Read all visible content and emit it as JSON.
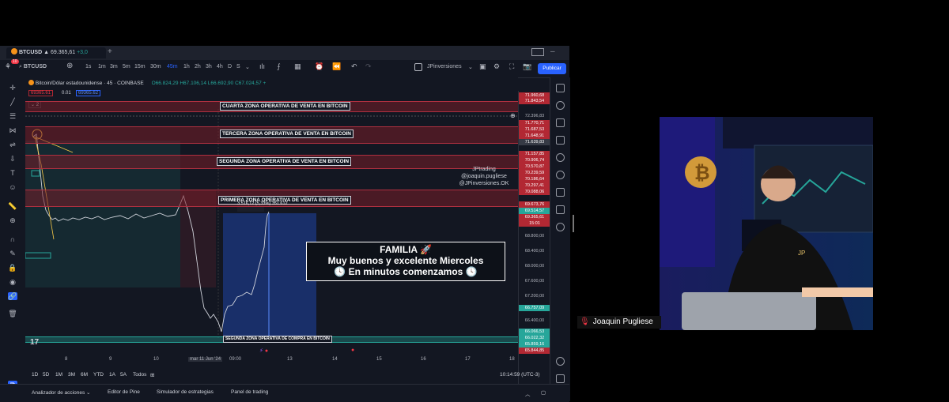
{
  "window": {
    "tab_symbol": "BTCUSD",
    "tab_price": "69.365,61",
    "tab_change": "+3,0",
    "badge_count": "10"
  },
  "toolbar": {
    "symbol": "BTCUSD",
    "intervals": [
      "1s",
      "1m",
      "3m",
      "5m",
      "15m",
      "30m",
      "45m",
      "1h",
      "2h",
      "3h",
      "4h",
      "D",
      "S"
    ],
    "active_interval": "45m",
    "layout_name": "JPinversiones",
    "publish_label": "Publicar"
  },
  "legend": {
    "title": "Bitcoin/Dólar estadounidense · 45 · COINBASE",
    "ohlc": "O66.824,29 H67.106,14 L66.692,90 C67.024,57 +",
    "bid": "69365.61",
    "spread": "0.01",
    "ask": "69365.62",
    "indicator_count": "2"
  },
  "zones": [
    "CUARTA ZONA OPERATIVA DE VENTA EN BITCOIN",
    "TERCERA ZONA OPERATIVA DE VENTA EN BITCOIN",
    "SEGUNDA ZONA OPERATIVA DE VENTA EN BITCOIN",
    "PRIMERA ZONA OPERATIVA DE VENTA EN BITCOIN",
    "SEGUNDA ZONA OPERATIVA DE COMPRA EN BITCOIN"
  ],
  "measure_label": "3.516,12 (5,33%) 351.612",
  "watermark": [
    "JPtrading",
    "@joaquin.pugliese",
    "@JPinversiones.OK"
  ],
  "message": {
    "line1": "FAMILIA 🚀",
    "line2": "Muy buenos y excelente Miercoles",
    "line3": "🕓 En minutos comenzamos 🕓"
  },
  "price_labels": [
    {
      "text": "71.960,68",
      "color": "#b22833"
    },
    {
      "text": "71.843,54",
      "color": "#b22833"
    },
    {
      "text": "72.396,83",
      "color": "#131722"
    },
    {
      "text": "71.770,71",
      "color": "#b22833"
    },
    {
      "text": "71.687,53",
      "color": "#b22833"
    },
    {
      "text": "71.648,91",
      "color": "#b22833"
    },
    {
      "text": "71.639,83",
      "color": "#363a45"
    },
    {
      "text": "71.157,85",
      "color": "#b22833"
    },
    {
      "text": "70.906,74",
      "color": "#b22833"
    },
    {
      "text": "70.570,87",
      "color": "#b22833"
    },
    {
      "text": "70.239,59",
      "color": "#b22833"
    },
    {
      "text": "70.186,64",
      "color": "#b22833"
    },
    {
      "text": "70.297,41",
      "color": "#b22833"
    },
    {
      "text": "70.088,06",
      "color": "#b22833"
    },
    {
      "text": "69.673,76",
      "color": "#b22833"
    },
    {
      "text": "69.514,57",
      "color": "#26a69a"
    },
    {
      "text": "69.365,61",
      "color": "#b22833"
    },
    {
      "text": "15:01",
      "color": "#b22833"
    },
    {
      "text": "68.800,00",
      "color": "#131722"
    },
    {
      "text": "68.400,00",
      "color": "#131722"
    },
    {
      "text": "68.000,00",
      "color": "#131722"
    },
    {
      "text": "67.600,00",
      "color": "#131722"
    },
    {
      "text": "67.200,00",
      "color": "#131722"
    },
    {
      "text": "66.757,09",
      "color": "#26a69a"
    },
    {
      "text": "66.400,00",
      "color": "#131722"
    },
    {
      "text": "66.066,53",
      "color": "#26a69a"
    },
    {
      "text": "66.022,32",
      "color": "#26a69a"
    },
    {
      "text": "65.859,16",
      "color": "#26a69a"
    },
    {
      "text": "65.844,85",
      "color": "#b22833"
    }
  ],
  "dates": [
    "8",
    "9",
    "10",
    "mar 11 Jun '24",
    "09:00",
    "13",
    "14",
    "15",
    "16",
    "17",
    "18"
  ],
  "ranges": [
    "1D",
    "5D",
    "1M",
    "3M",
    "6M",
    "YTD",
    "1A",
    "5A",
    "Todos"
  ],
  "clock": "10:14:59 (UTC-3)",
  "bottom_tabs": [
    "Analizador de acciones",
    "Editor de Pine",
    "Simulador de estrategias",
    "Panel de trading"
  ],
  "participant_name": "Joaquin Pugliese",
  "colors": {
    "accent": "#2962ff",
    "sell_zone": "#b22833",
    "buy_zone": "#26a69a",
    "background": "#131722"
  }
}
